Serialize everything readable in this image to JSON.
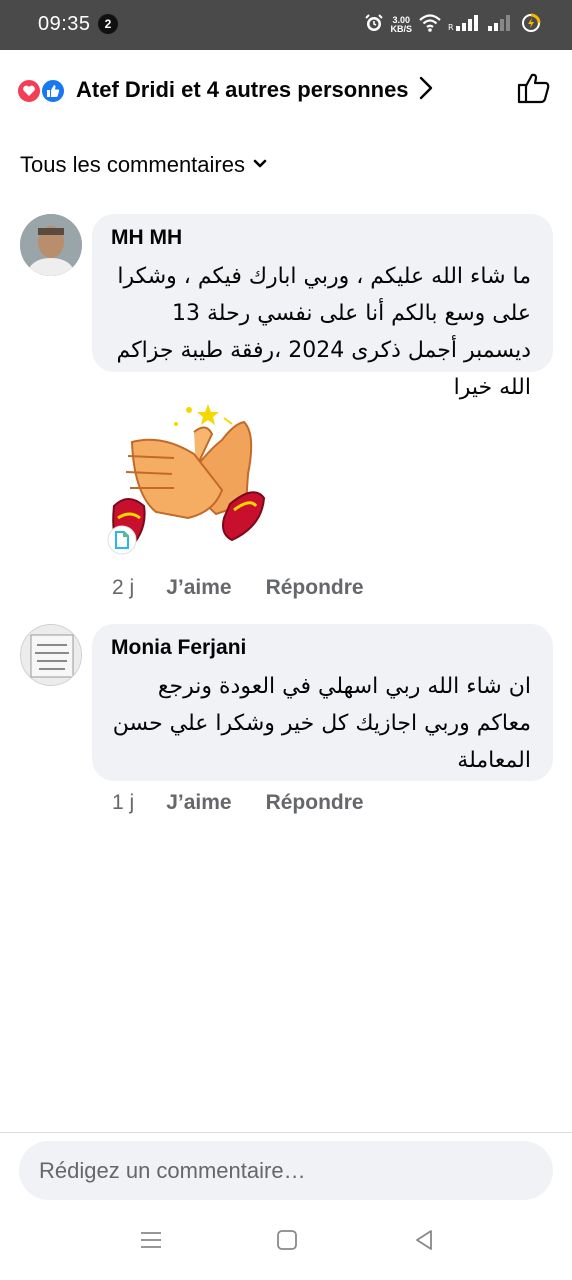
{
  "status_bar": {
    "time": "09:35",
    "notification_count": "2",
    "net_speed_value": "3.00",
    "net_speed_unit": "KB/S"
  },
  "reactions": {
    "summary": "Atef Dridi et 4 autres personnes"
  },
  "filter": {
    "label": "Tous les commentaires"
  },
  "comments": [
    {
      "author": "MH MH",
      "text": "ما شاء الله عليكم ، وربي ابارك فيكم ، وشكرا على وسع بالكم أنا على نفسي رحلة 13 ديسمبر أجمل ذكرى 2024 ،رفقة طيبة جزاكم الله خيرا",
      "time": "2 j",
      "like_label": "J’aime",
      "reply_label": "Répondre"
    },
    {
      "author": "Monia Ferjani",
      "text": "ان شاء الله ربي اسهلي في العودة ونرجع معاكم وربي اجازيك كل خير وشكرا علي حسن المعاملة",
      "time": "1 j",
      "like_label": "J’aime",
      "reply_label": "Répondre"
    }
  ],
  "composer": {
    "placeholder": "Rédigez un commentaire…"
  },
  "colors": {
    "status_bar_bg": "#4a4a4a",
    "bubble_bg": "#f0f2f5",
    "secondary_text": "#65676b",
    "love_red": "#f33e58",
    "like_blue": "#1877f2"
  }
}
